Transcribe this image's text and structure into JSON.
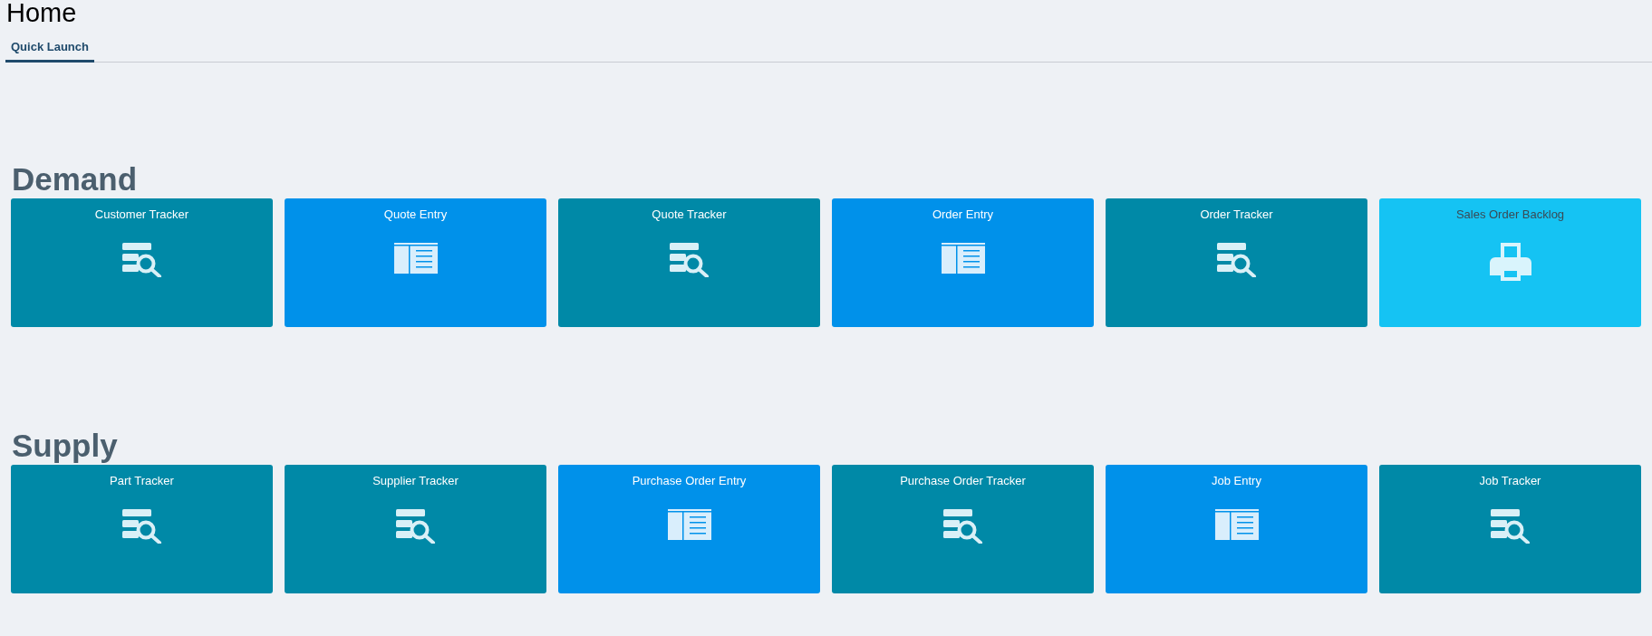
{
  "page": {
    "title": "Home"
  },
  "tabs": [
    {
      "label": "Quick Launch",
      "selected": true
    }
  ],
  "sections": [
    {
      "heading": "Demand",
      "tiles": [
        {
          "label": "Customer Tracker",
          "kind": "tracker"
        },
        {
          "label": "Quote Entry",
          "kind": "entry"
        },
        {
          "label": "Quote Tracker",
          "kind": "tracker"
        },
        {
          "label": "Order Entry",
          "kind": "entry"
        },
        {
          "label": "Order Tracker",
          "kind": "tracker"
        },
        {
          "label": "Sales Order Backlog",
          "kind": "report"
        }
      ]
    },
    {
      "heading": "Supply",
      "tiles": [
        {
          "label": "Part Tracker",
          "kind": "tracker"
        },
        {
          "label": "Supplier Tracker",
          "kind": "tracker"
        },
        {
          "label": "Purchase Order Entry",
          "kind": "entry"
        },
        {
          "label": "Purchase Order Tracker",
          "kind": "tracker"
        },
        {
          "label": "Job Entry",
          "kind": "entry"
        },
        {
          "label": "Job Tracker",
          "kind": "tracker"
        }
      ]
    }
  ]
}
